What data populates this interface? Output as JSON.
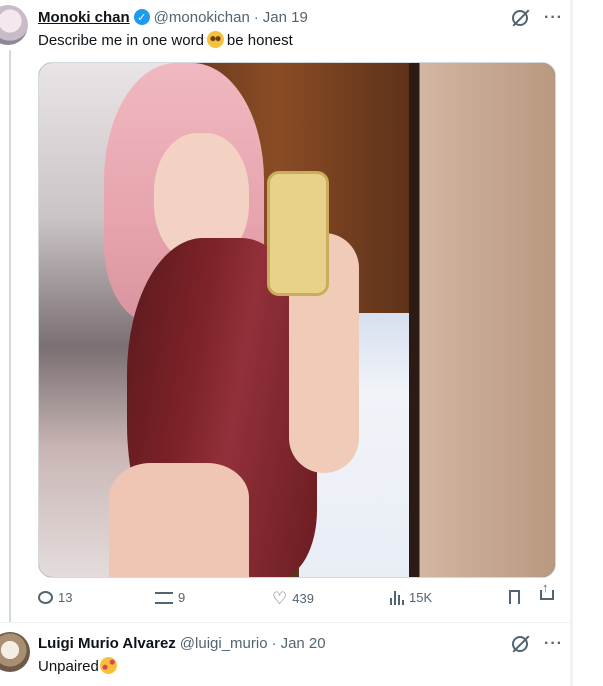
{
  "tweet": {
    "author_name": "Monoki chan",
    "handle": "@monokichan",
    "separator": "·",
    "date": "Jan 19",
    "text_before": "Describe me in one word",
    "text_after": "be honest",
    "emoji": "pleading-face",
    "media_alt": "mirror selfie photo",
    "stats": {
      "replies": "13",
      "reposts": "9",
      "likes": "439",
      "views": "15K"
    }
  },
  "reply": {
    "author_name": "Luigi Murio Alvarez",
    "handle": "@luigi_murio",
    "separator": "·",
    "date": "Jan 20",
    "text": "Unpaired",
    "emoji": "smiling-face-with-hearts"
  },
  "icons": {
    "grok": "grok-icon",
    "more": "more-icon",
    "reply": "reply-icon",
    "repost": "repost-icon",
    "like": "heart-icon",
    "views": "views-icon",
    "bookmark": "bookmark-icon",
    "share": "share-icon"
  },
  "colors": {
    "verified": "#1d9bf0",
    "muted_text": "#536471",
    "text": "#0f1419"
  },
  "glyphs": {
    "more": "···",
    "heart": "♡"
  }
}
